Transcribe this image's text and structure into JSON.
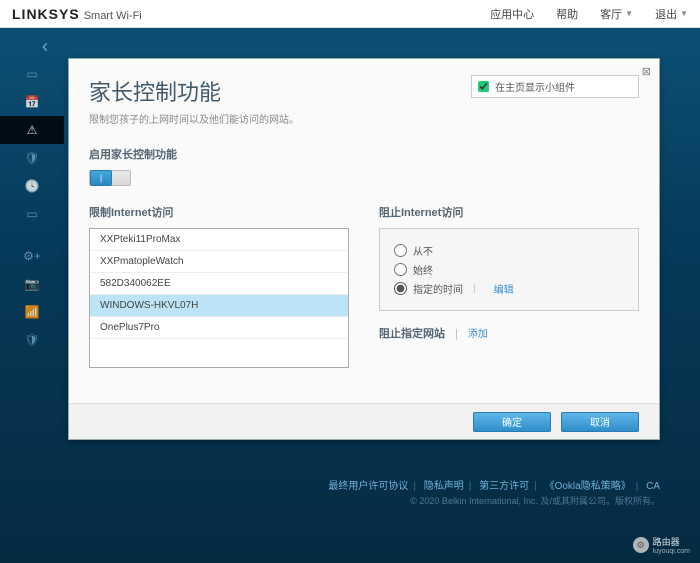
{
  "brand": {
    "logo": "LINKSYS",
    "sub": "Smart Wi-Fi"
  },
  "topnav": {
    "appcenter": "应用中心",
    "help": "帮助",
    "guest": "客厅",
    "logout": "退出"
  },
  "card": {
    "title": "家长控制功能",
    "subtitle": "限制您孩子的上网时间以及他们能访问的网站。",
    "widget_label": "在主页显示小组件",
    "enable_heading": "启用家长控制功能",
    "limit_heading": "限制Internet访问",
    "block_heading": "阻止Internet访问",
    "block_sites_heading": "阻止指定网站",
    "add_label": "添加",
    "edit_label": "编辑",
    "radios": {
      "never": "从不",
      "always": "始终",
      "specific": "指定的时间"
    },
    "devices": [
      "XXPteki11ProMax",
      "XXPmatopleWatch",
      "582D340062EE",
      "WINDOWS-HKVL07H",
      "OnePlus7Pro"
    ],
    "selected_device_index": 3,
    "buttons": {
      "ok": "确定",
      "cancel": "取消"
    }
  },
  "footer": {
    "eula": "最终用户许可协议",
    "privacy": "隐私声明",
    "thirdparty": "第三方许可",
    "ookla": "《Ookla隐私策略》",
    "ca": "CA",
    "copyright": "© 2020 Belkin International, Inc. 及/或其附属公司。版权所有。"
  },
  "watermark": {
    "label": "路由器",
    "sub": "luyouqi.com"
  },
  "rail_icons": [
    "▭",
    "📅",
    "⚠",
    "🛡",
    "🕓",
    "▭",
    "",
    "⚙+",
    "📷",
    "📶",
    "🛡"
  ]
}
